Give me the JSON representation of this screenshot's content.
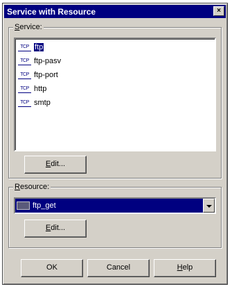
{
  "window": {
    "title": "Service with Resource",
    "close_glyph": "×"
  },
  "service_group": {
    "label_mnemonic": "S",
    "label_rest": "ervice:",
    "items": [
      {
        "protocol": "TCP",
        "name": "ftp",
        "selected": true
      },
      {
        "protocol": "TCP",
        "name": "ftp-pasv",
        "selected": false
      },
      {
        "protocol": "TCP",
        "name": "ftp-port",
        "selected": false
      },
      {
        "protocol": "TCP",
        "name": "http",
        "selected": false
      },
      {
        "protocol": "TCP",
        "name": "smtp",
        "selected": false
      }
    ],
    "edit_button": {
      "mnemonic": "E",
      "rest": "dit..."
    }
  },
  "resource_group": {
    "label_mnemonic": "R",
    "label_rest": "esource:",
    "selected_value": "ftp_get",
    "edit_button": {
      "mnemonic": "E",
      "rest": "dit..."
    }
  },
  "footer": {
    "ok_label": "OK",
    "cancel_label": "Cancel",
    "help_mnemonic": "H",
    "help_rest": "elp"
  }
}
